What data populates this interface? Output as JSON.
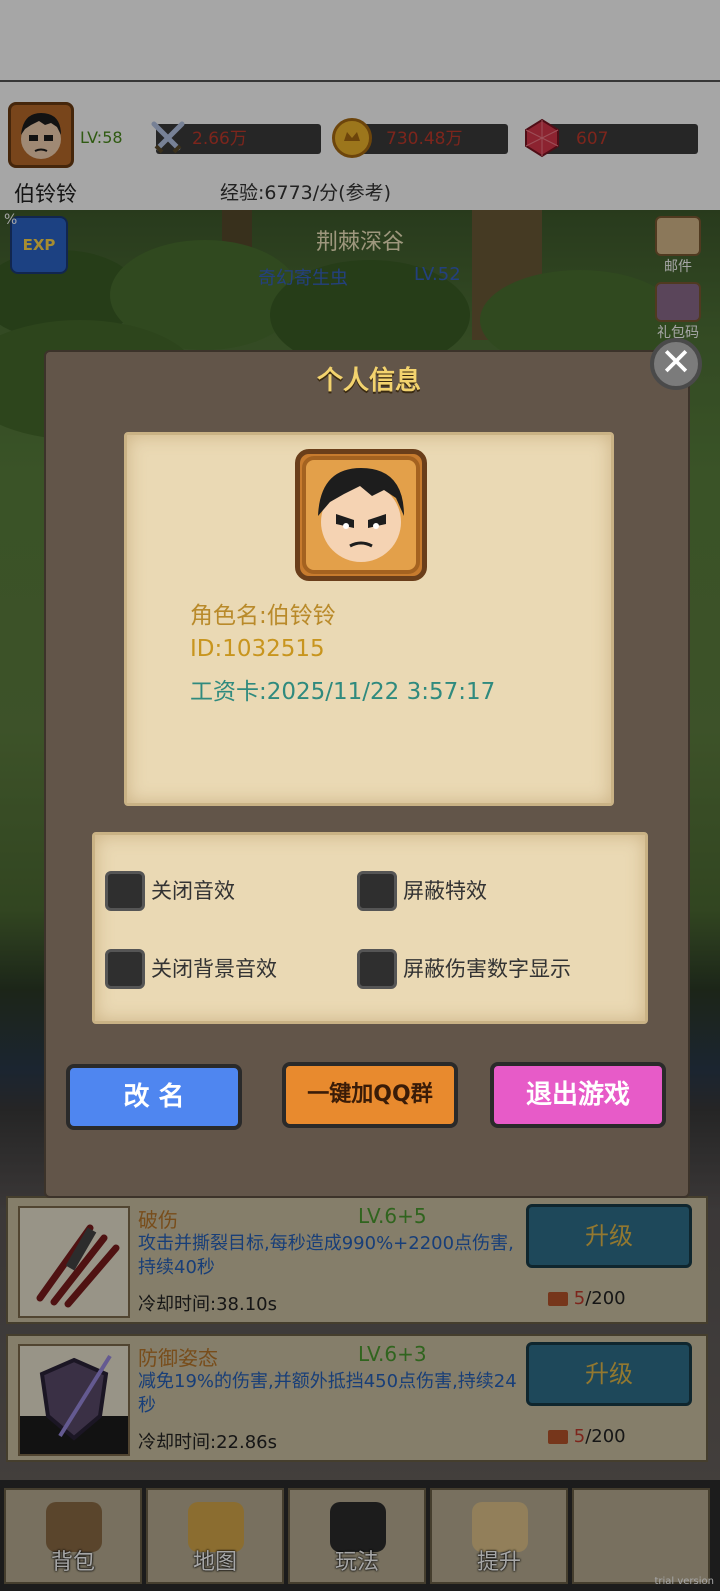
{
  "header": {
    "level": "LV:58",
    "power": "2.66万",
    "gold": "730.48万",
    "gems": "607",
    "player_name": "伯铃铃",
    "exp_rate": "经验:6773/分(参考)"
  },
  "scene": {
    "location": "荆棘深谷",
    "monster": "奇幻寄生虫",
    "monster_level": "LV.52",
    "exp_badge": "EXP",
    "exp_percent": "%",
    "side_buttons": [
      "邮件",
      "礼包码"
    ]
  },
  "skills": [
    {
      "name": "破伤",
      "level": "LV.6+5",
      "desc": "攻击并撕裂目标,每秒造成990%+2200点伤害,持续40秒",
      "cooldown": "冷却时间:38.10s",
      "button": "升级",
      "cost_have": "5",
      "cost_need": "/200"
    },
    {
      "name": "防御姿态",
      "level": "LV.6+3",
      "desc": "减免19%的伤害,并额外抵挡450点伤害,持续24秒",
      "cooldown": "冷却时间:22.86s",
      "button": "升级",
      "cost_have": "5",
      "cost_need": "/200"
    }
  ],
  "nav": [
    "背包",
    "地图",
    "玩法",
    "提升"
  ],
  "watermark": "trial version",
  "modal": {
    "title": "个人信息",
    "close": "✕",
    "role_name": "角色名:伯铃铃",
    "id": "ID:1032515",
    "salary": "工资卡:2025/11/22 3:57:17",
    "options": [
      {
        "label": "关闭音效",
        "checked": false
      },
      {
        "label": "屏蔽特效",
        "checked": false
      },
      {
        "label": "关闭背景音效",
        "checked": false
      },
      {
        "label": "屏蔽伤害数字显示",
        "checked": false
      }
    ],
    "buttons": {
      "rename": "改 名",
      "join_qq": "一键加QQ群",
      "exit": "退出游戏"
    }
  },
  "colors": {
    "rename_btn": "#4f86f0",
    "qq_btn": "#e88a2e",
    "exit_btn": "#e75bc8",
    "title": "#f3d36e",
    "role_name": "#b98a2a",
    "id": "#c8951e",
    "salary": "#2f8a7e"
  }
}
